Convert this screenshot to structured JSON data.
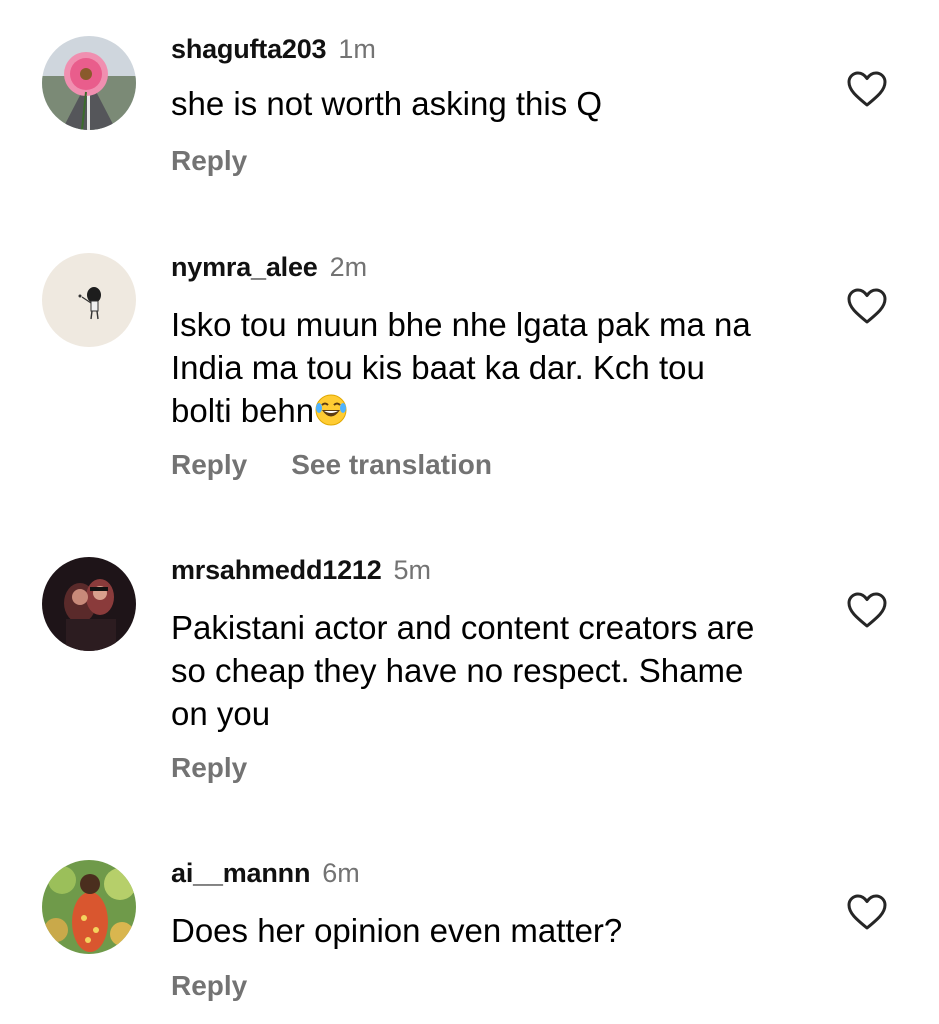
{
  "comments": [
    {
      "username": "shagufta203",
      "time": "1m",
      "text": "she is not worth asking this Q",
      "reply_label": "Reply",
      "avatar_icon": "flower-avatar",
      "like_icon": "heart-outline-icon"
    },
    {
      "username": "nymra_alee",
      "time": "2m",
      "text": "Isko tou muun bhe nhe lgata pak ma na India ma tou kis baat ka dar. Kch tou bolti behn",
      "emoji": "face-with-tears-of-joy",
      "reply_label": "Reply",
      "translate_label": "See translation",
      "avatar_icon": "girl-drawing-avatar",
      "like_icon": "heart-outline-icon"
    },
    {
      "username": "mrsahmedd1212",
      "time": "5m",
      "text": "Pakistani actor and content creators are so cheap they have no respect. Shame on you",
      "reply_label": "Reply",
      "avatar_icon": "couple-photo-avatar",
      "like_icon": "heart-outline-icon"
    },
    {
      "username": "ai__mannn",
      "time": "6m",
      "text": "Does her opinion even matter?",
      "reply_label": "Reply",
      "avatar_icon": "painting-avatar",
      "like_icon": "heart-outline-icon"
    }
  ],
  "colors": {
    "secondary_text": "#737373",
    "primary_text": "#000000",
    "background": "#ffffff"
  }
}
